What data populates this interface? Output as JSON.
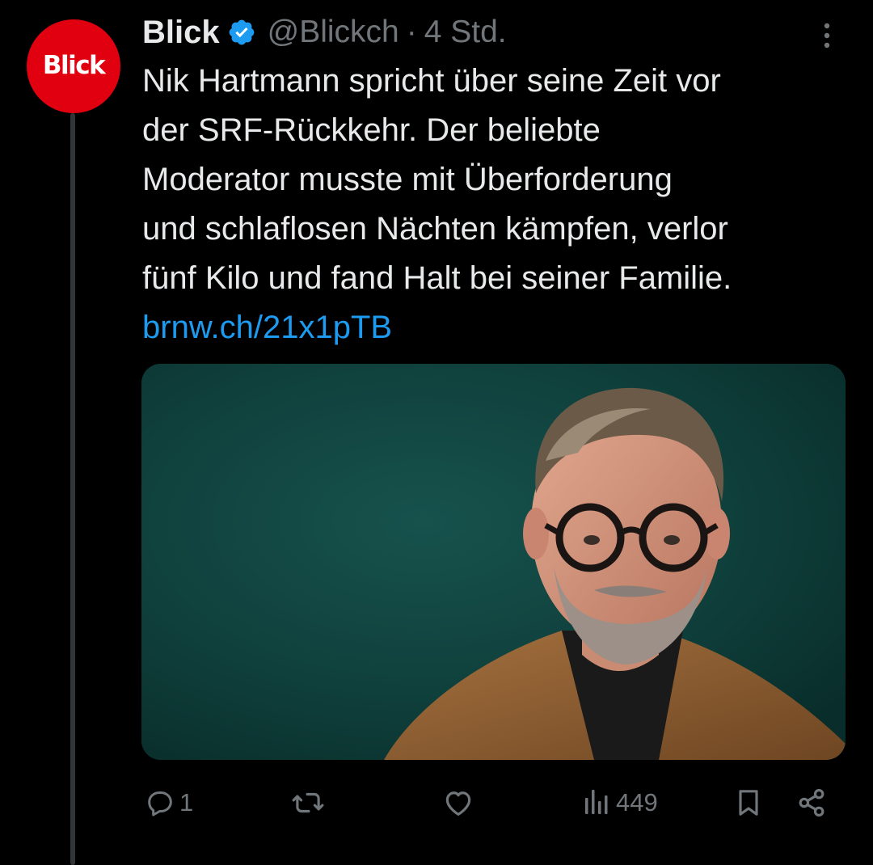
{
  "post": {
    "author": {
      "display_name": "Blick",
      "handle": "@Blickch",
      "avatar_text": "Blick",
      "verified": true
    },
    "separator": "·",
    "time": "4 Std.",
    "text_lines": [
      "Nik Hartmann spricht über seine Zeit vor",
      "der SRF-Rückkehr. Der beliebte",
      "Moderator musste mit Überforderung",
      "und schlaflosen Nächten kämpfen, verlor",
      "fünf Kilo und fand Halt bei seiner Familie."
    ],
    "link": "brnw.ch/21x1pTB",
    "media": {
      "type": "photo"
    }
  },
  "actions": {
    "reply_count": "1",
    "repost_count": "",
    "like_count": "",
    "views_count": "449"
  },
  "icons": {
    "verified": "verified-badge-icon",
    "more": "more-vertical-icon",
    "reply": "reply-icon",
    "repost": "repost-icon",
    "like": "heart-icon",
    "views": "views-icon",
    "bookmark": "bookmark-icon",
    "share": "share-icon"
  },
  "colors": {
    "background": "#000000",
    "text_primary": "#e7e9ea",
    "text_secondary": "#71767b",
    "link": "#1d9bf0",
    "verified": "#1d9bf0",
    "avatar_bg": "#e1000f",
    "thread_line": "#333639"
  }
}
